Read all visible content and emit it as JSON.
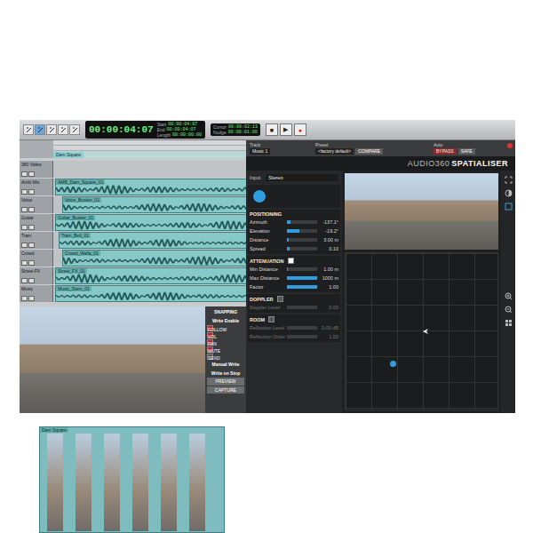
{
  "toolbar": {
    "edit_tools": [
      {
        "selected": false
      },
      {
        "selected": true
      },
      {
        "selected": false
      },
      {
        "selected": false
      },
      {
        "selected": false
      }
    ],
    "counter": "00:00:04:07",
    "counter_fields": [
      {
        "label": "Start",
        "value": "00:00:04:07"
      },
      {
        "label": "End",
        "value": "00:00:04:07"
      },
      {
        "label": "Length",
        "value": "00:00:00:00"
      }
    ],
    "cursor": {
      "label": "Cursor",
      "value": "00:00:02:13"
    },
    "nudge": {
      "label": "Nudge",
      "value": "00:00:01:00"
    },
    "transport": [
      {
        "glyph": "■",
        "kind": "stop"
      },
      {
        "glyph": "▶",
        "kind": "play"
      },
      {
        "glyph": "●",
        "kind": "record"
      }
    ]
  },
  "marker": "Dam Square",
  "tracks": [
    {
      "name": "360 Video",
      "kind": "video",
      "clip": "Dam Square"
    },
    {
      "name": "Ambi Mix",
      "kind": "audio",
      "clip": "AMB_Dam_Square_01"
    },
    {
      "name": "Voice",
      "kind": "audio",
      "clip": "Voice_Busker_01"
    },
    {
      "name": "Guitar",
      "kind": "audio",
      "clip": "Guitar_Busker_01"
    },
    {
      "name": "Tram",
      "kind": "audio",
      "clip": "Tram_Bell_01"
    },
    {
      "name": "Crowd",
      "kind": "audio",
      "clip": "Crowd_Walla_01"
    },
    {
      "name": "Street FX",
      "kind": "audio",
      "clip": "Street_FX_01"
    },
    {
      "name": "Music",
      "kind": "audio",
      "clip": "Music_Stem_01"
    }
  ],
  "automation": [
    {
      "label": "SNAPPING",
      "kind": "header",
      "on": false
    },
    {
      "label": "Write Enable",
      "kind": "header",
      "on": false
    },
    {
      "label": "FOLLOW",
      "kind": "toggle",
      "on": true
    },
    {
      "label": "VOL",
      "kind": "toggle",
      "on": true
    },
    {
      "label": "PAN",
      "kind": "toggle",
      "on": true
    },
    {
      "label": "MUTE",
      "kind": "toggle",
      "on": true
    },
    {
      "label": "SEND",
      "kind": "toggle",
      "on": false
    },
    {
      "label": "Manual Write",
      "kind": "header",
      "on": false
    },
    {
      "label": "Write on Stop",
      "kind": "header",
      "on": false
    },
    {
      "label": "PREVIEW",
      "kind": "button",
      "on": false
    },
    {
      "label": "CAPTURE",
      "kind": "button",
      "on": false
    }
  ],
  "plugin": {
    "header": [
      {
        "label": "Track",
        "value": "Music 1"
      },
      {
        "label": "Preset",
        "value": "<factory default>"
      },
      {
        "label": "Auto",
        "value": "BYPASS"
      }
    ],
    "header_buttons": [
      "COMPARE",
      "SAFE"
    ],
    "brand": "AUDIO360",
    "product": "SPATIALISER",
    "input": {
      "label": "Input",
      "value": "Stereo"
    },
    "sections": [
      {
        "title": "POSITIONING",
        "toggle": false,
        "enabled": true,
        "params": [
          {
            "name": "Azimuth",
            "value": "-137.1°",
            "level": 0.12
          },
          {
            "name": "Elevation",
            "value": "-19.2°",
            "level": 0.4
          },
          {
            "name": "Distance",
            "value": "3.00 m",
            "level": 0.05
          },
          {
            "name": "Spread",
            "value": "0.10",
            "level": 0.1
          }
        ]
      },
      {
        "title": "ATTENUATION",
        "toggle": true,
        "enabled": true,
        "params": [
          {
            "name": "Min Distance",
            "value": "1.00 m",
            "level": 0.02
          },
          {
            "name": "Max Distance",
            "value": "1000 m",
            "level": 1.0
          },
          {
            "name": "Factor",
            "value": "1.00",
            "level": 1.0
          }
        ]
      },
      {
        "title": "DOPPLER",
        "toggle": true,
        "enabled": false,
        "params": [
          {
            "name": "Doppler Level",
            "value": "0.00",
            "level": 0.0
          }
        ]
      },
      {
        "title": "ROOM",
        "toggle": true,
        "enabled": false,
        "params": [
          {
            "name": "Reflection Level",
            "value": "0.00 dB",
            "level": 0.0
          },
          {
            "name": "Reflection Order",
            "value": "1.00",
            "level": 0.0
          }
        ]
      }
    ]
  }
}
